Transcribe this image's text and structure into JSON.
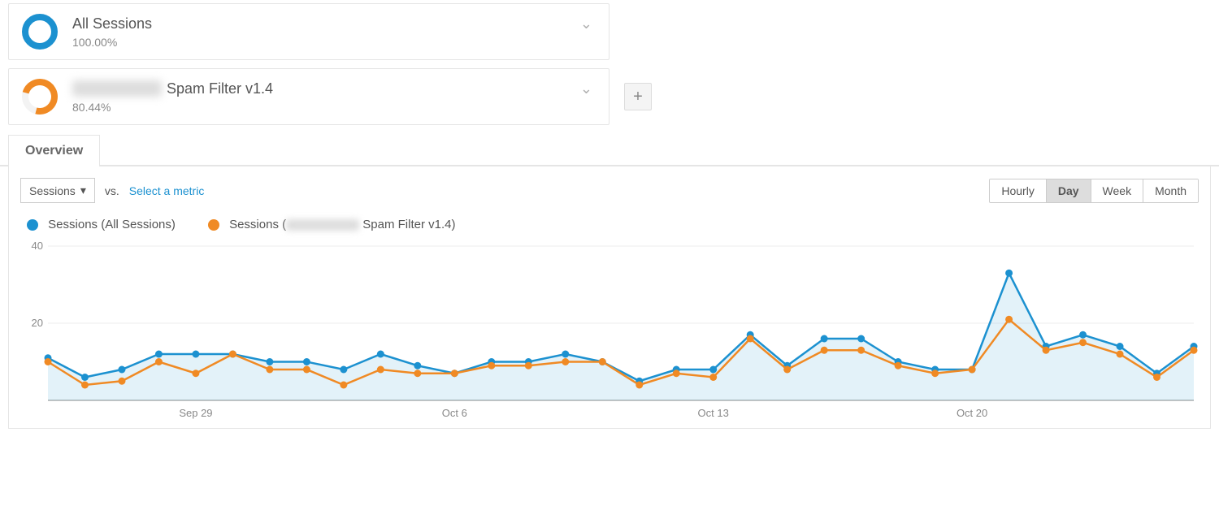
{
  "segments": [
    {
      "title": "All Sessions",
      "pct": "100.00%",
      "donut_class": "donut-blue",
      "blurred_prefix": false
    },
    {
      "title": "Spam Filter v1.4",
      "pct": "80.44%",
      "donut_class": "donut-orange",
      "blurred_prefix": true
    }
  ],
  "tab_label": "Overview",
  "metric_selector": "Sessions",
  "vs_label": "vs.",
  "select_metric_label": "Select a metric",
  "granularity": {
    "options": [
      "Hourly",
      "Day",
      "Week",
      "Month"
    ],
    "active": "Day"
  },
  "legend": {
    "a": "Sessions (All Sessions)",
    "b_prefix": "Sessions (",
    "b_suffix": " Spam Filter v1.4)"
  },
  "chart_data": {
    "type": "line",
    "xlabel": "",
    "ylabel": "",
    "ylim": [
      0,
      40
    ],
    "yticks": [
      20,
      40
    ],
    "x_tick_labels": {
      "4": "Sep 29",
      "11": "Oct 6",
      "18": "Oct 13",
      "25": "Oct 20"
    },
    "categories": [
      0,
      1,
      2,
      3,
      4,
      5,
      6,
      7,
      8,
      9,
      10,
      11,
      12,
      13,
      14,
      15,
      16,
      17,
      18,
      19,
      20,
      21,
      22,
      23,
      24,
      25,
      26,
      27,
      28,
      29,
      30,
      31
    ],
    "series": [
      {
        "name": "Sessions (All Sessions)",
        "color": "#1c91d0",
        "fill": "rgba(28,145,208,0.12)",
        "values": [
          11,
          6,
          8,
          12,
          12,
          12,
          10,
          10,
          8,
          12,
          9,
          7,
          10,
          10,
          12,
          10,
          5,
          8,
          8,
          17,
          9,
          16,
          16,
          10,
          8,
          8,
          33,
          14,
          17,
          14,
          7,
          14
        ]
      },
      {
        "name": "Sessions (Spam Filter v1.4)",
        "color": "#f08a24",
        "fill": "none",
        "values": [
          10,
          4,
          5,
          10,
          7,
          12,
          8,
          8,
          4,
          8,
          7,
          7,
          9,
          9,
          10,
          10,
          4,
          7,
          6,
          16,
          8,
          13,
          13,
          9,
          7,
          8,
          21,
          13,
          15,
          12,
          6,
          13
        ]
      }
    ]
  },
  "colors": {
    "blue": "#1c91d0",
    "orange": "#f08a24"
  }
}
